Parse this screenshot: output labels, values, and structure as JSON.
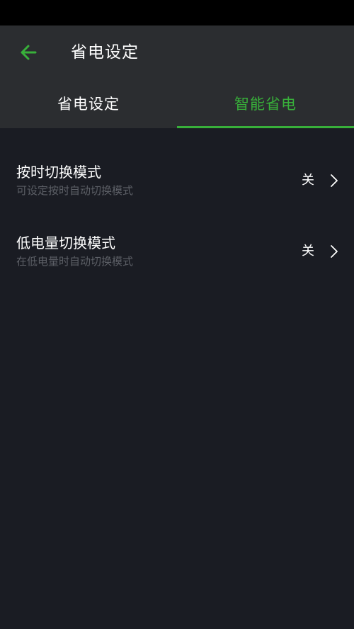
{
  "header": {
    "title": "省电设定",
    "back_icon": "arrow-left-icon",
    "accent_color": "#38b03a"
  },
  "tabs": [
    {
      "label": "省电设定",
      "active": false
    },
    {
      "label": "智能省电",
      "active": true
    }
  ],
  "settings": [
    {
      "title": "按时切换模式",
      "subtitle": "可设定按时自动切换模式",
      "value": "关",
      "icon": "chevron-right-icon"
    },
    {
      "title": "低电量切换模式",
      "subtitle": "在低电量时自动切换模式",
      "value": "关",
      "icon": "chevron-right-icon"
    }
  ]
}
